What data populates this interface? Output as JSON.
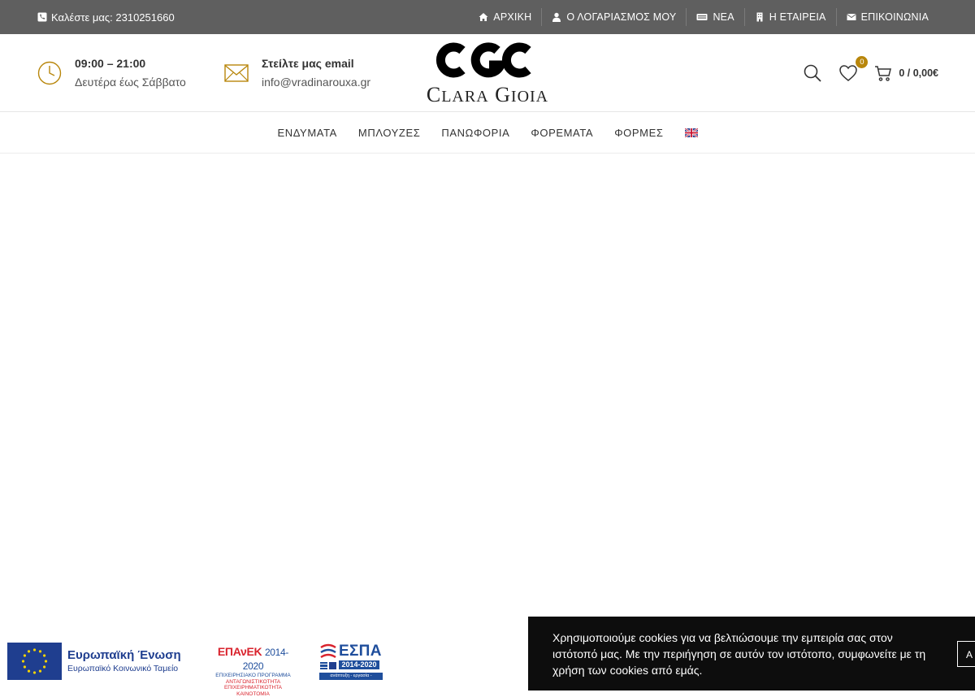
{
  "topbar": {
    "call_text": "Καλέστε μας: 2310251660",
    "nav": [
      {
        "label": "ΑΡΧΙΚΗ",
        "icon": "home-icon"
      },
      {
        "label": "Ο ΛΟΓΑΡΙΑΣΜΟΣ ΜΟΥ",
        "icon": "user-icon"
      },
      {
        "label": "ΝΕΑ",
        "icon": "newspaper-icon"
      },
      {
        "label": "Η ΕΤΑΙΡΕΙΑ",
        "icon": "building-icon"
      },
      {
        "label": "ΕΠΙΚΟΙΝΩΝΙΑ",
        "icon": "envelope-icon"
      }
    ]
  },
  "header": {
    "hours": {
      "title": "09:00 – 21:00",
      "subtitle": "Δευτέρα έως Σάββατο"
    },
    "email": {
      "title": "Στείλτε μας email",
      "subtitle": "info@vradinarouxa.gr"
    },
    "logo": {
      "monogram": "CGC",
      "name": "Clara Gioia"
    },
    "wishlist_count": "0",
    "cart_text": "0 / 0,00€",
    "accent_color": "#b8860b"
  },
  "main_nav": [
    "ΕΝΔΥΜΑΤΑ",
    "ΜΠΛΟΥΖΕΣ",
    "ΠΑΝΩΦΟΡΙΑ",
    "ΦΟΡΕΜΑΤΑ",
    "ΦΟΡΜΕΣ"
  ],
  "footer_logos": {
    "eu": {
      "title": "Ευρωπαϊκή Ένωση",
      "subtitle": "Ευρωπαϊκό Κοινωνικό Ταμείο"
    },
    "epanek": {
      "title": "ΕΠΑνΕΚ",
      "years": "2014-2020",
      "lines": [
        "ΕΠΙΧΕΙΡΗΣΙΑΚΟ ΠΡΟΓΡΑΜΜΑ",
        "ΑΝΤΑΓΩΝΙΣΤΙΚΟΤΗΤΑ",
        "ΕΠΙΧΕΙΡΗΜΑΤΙΚΟΤΗΤΑ",
        "ΚΑΙΝΟΤΟΜΙΑ"
      ]
    },
    "espa": {
      "title": "ΕΣΠΑ",
      "years": "2014-2020",
      "slogan": "ανάπτυξη - εργασία - αλληλεγγύη"
    }
  },
  "cookie": {
    "message": "Χρησιμοποιούμε cookies για να βελτιώσουμε την εμπειρία σας στον ιστότοπό μας. Με την περιήγηση σε αυτόν τον ιστότοπο, συμφωνείτε με τη χρήση των cookies από εμάς.",
    "accept_label": "Α"
  }
}
